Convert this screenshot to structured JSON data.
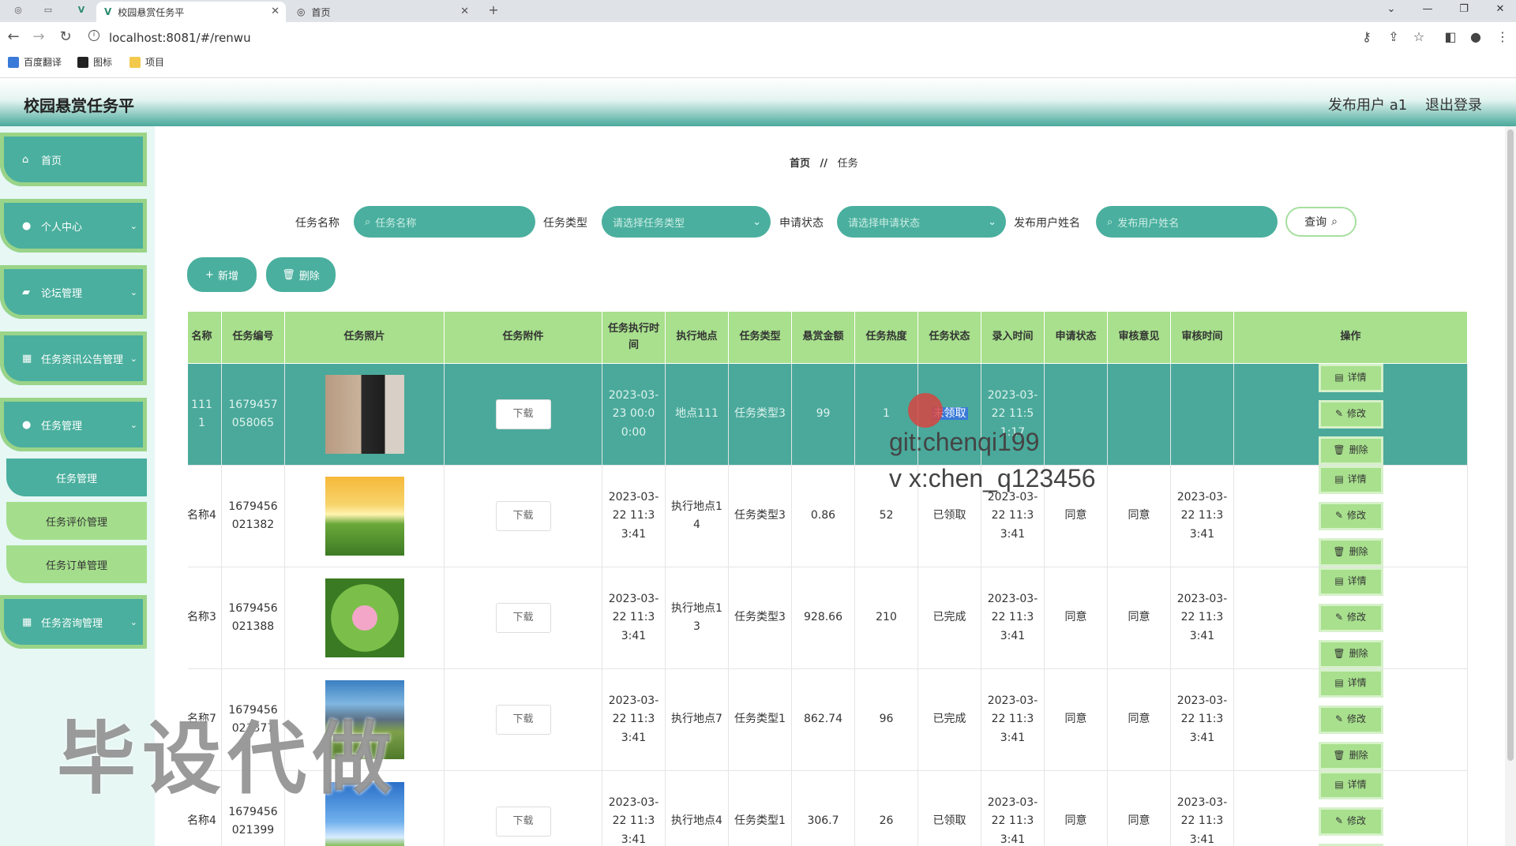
{
  "browser": {
    "tabs": [
      {
        "title": "校园悬赏任务平",
        "active": true
      },
      {
        "title": "首页",
        "active": false
      }
    ],
    "url": "localhost:8081/#/renwu",
    "bookmarks": [
      "百度翻译",
      "图标",
      "项目"
    ]
  },
  "header": {
    "title": "校园悬赏任务平",
    "user": "发布用户 a1",
    "logout": "退出登录"
  },
  "sidebar": {
    "items": [
      {
        "label": "首页",
        "icon": "home-icon"
      },
      {
        "label": "个人中心",
        "icon": "person-icon"
      },
      {
        "label": "论坛管理",
        "icon": "forum-icon"
      },
      {
        "label": "任务资讯公告管理",
        "icon": "news-icon"
      },
      {
        "label": "任务管理",
        "icon": "person-icon"
      },
      {
        "label": "任务咨询管理",
        "icon": "grid-icon"
      }
    ],
    "subitems": [
      {
        "label": "任务管理",
        "active": true
      },
      {
        "label": "任务评价管理",
        "active": false
      },
      {
        "label": "任务订单管理",
        "active": false
      }
    ]
  },
  "breadcrumb": {
    "home": "首页",
    "sep": "//",
    "current": "任务"
  },
  "search": {
    "name_label": "任务名称",
    "name_placeholder": "任务名称",
    "type_label": "任务类型",
    "type_placeholder": "请选择任务类型",
    "status_label": "申请状态",
    "status_placeholder": "请选择申请状态",
    "user_label": "发布用户姓名",
    "user_placeholder": "发布用户姓名",
    "query": "查询"
  },
  "actions": {
    "add": "新增",
    "delete": "删除"
  },
  "table": {
    "headers": [
      "名称",
      "任务编号",
      "任务照片",
      "任务附件",
      "任务执行时间",
      "执行地点",
      "任务类型",
      "悬赏金额",
      "任务热度",
      "任务状态",
      "录入时间",
      "申请状态",
      "审核意见",
      "审核时间",
      "操作"
    ],
    "download": "下载",
    "op_detail": "详情",
    "op_edit": "修改",
    "op_delete": "删除",
    "rows": [
      {
        "name": "111 1",
        "no": "1679457058065",
        "photo": "portrait",
        "exec_time": "2023-03-23 00:00:00",
        "place": "地点111",
        "type": "任务类型3",
        "amount": "99",
        "heat": "1",
        "status": "未领取",
        "entry_time": "2023-03-22 11:51:17",
        "apply": "",
        "review": "",
        "review_time": ""
      },
      {
        "name": "名称4",
        "no": "1679456021382",
        "photo": "sunflower",
        "exec_time": "2023-03-22 11:33:41",
        "place": "执行地点14",
        "type": "任务类型3",
        "amount": "0.86",
        "heat": "52",
        "status": "已领取",
        "entry_time": "2023-03-22 11:33:41",
        "apply": "同意",
        "review": "同意",
        "review_time": "2023-03-22 11:33:41"
      },
      {
        "name": "名称3",
        "no": "1679456021388",
        "photo": "lotus",
        "exec_time": "2023-03-22 11:33:41",
        "place": "执行地点13",
        "type": "任务类型3",
        "amount": "928.66",
        "heat": "210",
        "status": "已完成",
        "entry_time": "2023-03-22 11:33:41",
        "apply": "同意",
        "review": "同意",
        "review_time": "2023-03-22 11:33:41"
      },
      {
        "name": "名称7",
        "no": "1679456021377",
        "photo": "mountain",
        "exec_time": "2023-03-22 11:33:41",
        "place": "执行地点7",
        "type": "任务类型1",
        "amount": "862.74",
        "heat": "96",
        "status": "已完成",
        "entry_time": "2023-03-22 11:33:41",
        "apply": "同意",
        "review": "同意",
        "review_time": "2023-03-22 11:33:41"
      },
      {
        "name": "名称4",
        "no": "1679456021399",
        "photo": "sky",
        "exec_time": "2023-03-22 11:33:41",
        "place": "执行地点4",
        "type": "任务类型1",
        "amount": "306.7",
        "heat": "26",
        "status": "已领取",
        "entry_time": "2023-03-22 11:33:41",
        "apply": "同意",
        "review": "同意",
        "review_time": "2023-03-22 11:33:41"
      }
    ]
  },
  "watermarks": {
    "git": "git:chenqi199",
    "vx": "v x:chen_q123456",
    "big": "毕设代做"
  },
  "colors": {
    "primary": "#4aaf9e",
    "accent": "#a8e08d",
    "header_bg": "#a8e08d"
  }
}
